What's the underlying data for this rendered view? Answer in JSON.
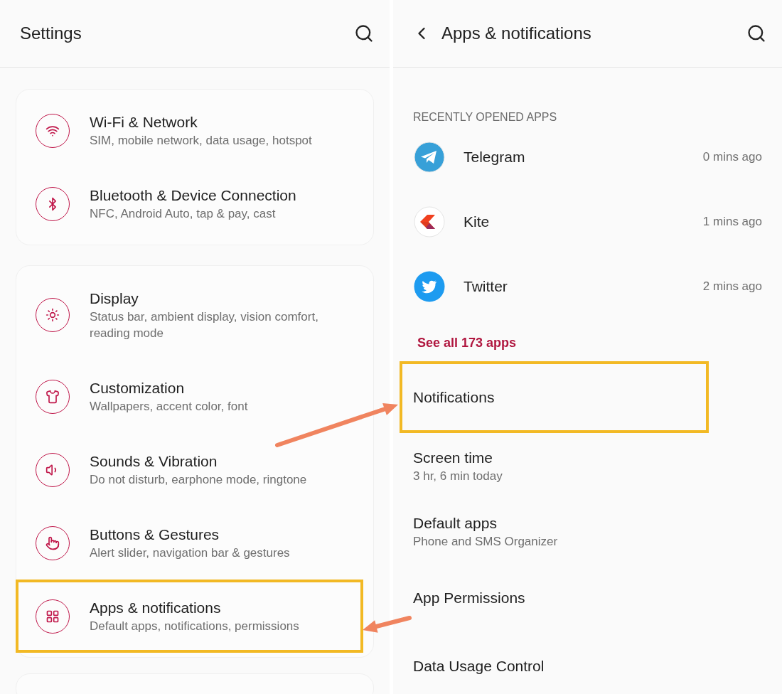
{
  "settings": {
    "title": "Settings",
    "groups": [
      {
        "items": [
          {
            "kind": "wifi",
            "title": "Wi-Fi & Network",
            "subtitle": "SIM, mobile network, data usage, hotspot",
            "highlighted": false
          },
          {
            "kind": "bluetooth",
            "title": "Bluetooth & Device Connection",
            "subtitle": "NFC, Android Auto, tap & pay, cast",
            "highlighted": false
          }
        ]
      },
      {
        "items": [
          {
            "kind": "brightness",
            "title": "Display",
            "subtitle": "Status bar, ambient display, vision comfort, reading mode",
            "highlighted": false
          },
          {
            "kind": "shirt",
            "title": "Customization",
            "subtitle": "Wallpapers, accent color, font",
            "highlighted": false
          },
          {
            "kind": "speaker",
            "title": "Sounds & Vibration",
            "subtitle": "Do not disturb, earphone mode, ringtone",
            "highlighted": false
          },
          {
            "kind": "touch",
            "title": "Buttons & Gestures",
            "subtitle": "Alert slider, navigation bar & gestures",
            "highlighted": false
          },
          {
            "kind": "grid",
            "title": "Apps & notifications",
            "subtitle": "Default apps, notifications, permissions",
            "highlighted": true
          }
        ]
      }
    ]
  },
  "apps_screen": {
    "title": "Apps & notifications",
    "section_label": "RECENTLY OPENED APPS",
    "recent_apps": [
      {
        "kind": "plane",
        "name": "Telegram",
        "time": "0 mins ago"
      },
      {
        "kind": "chevron",
        "name": "Kite",
        "time": "1 mins ago"
      },
      {
        "kind": "bird",
        "name": "Twitter",
        "time": "2 mins ago"
      }
    ],
    "see_all": "See all 173 apps",
    "items": [
      {
        "title": "Notifications",
        "highlighted": true
      },
      {
        "title": "Screen time",
        "subtitle": "3 hr, 6 min today",
        "highlighted": false
      },
      {
        "title": "Default apps",
        "subtitle": "Phone and SMS Organizer",
        "highlighted": false
      },
      {
        "title": "App Permissions",
        "highlighted": false
      },
      {
        "title": "Data Usage Control",
        "highlighted": false
      }
    ]
  }
}
